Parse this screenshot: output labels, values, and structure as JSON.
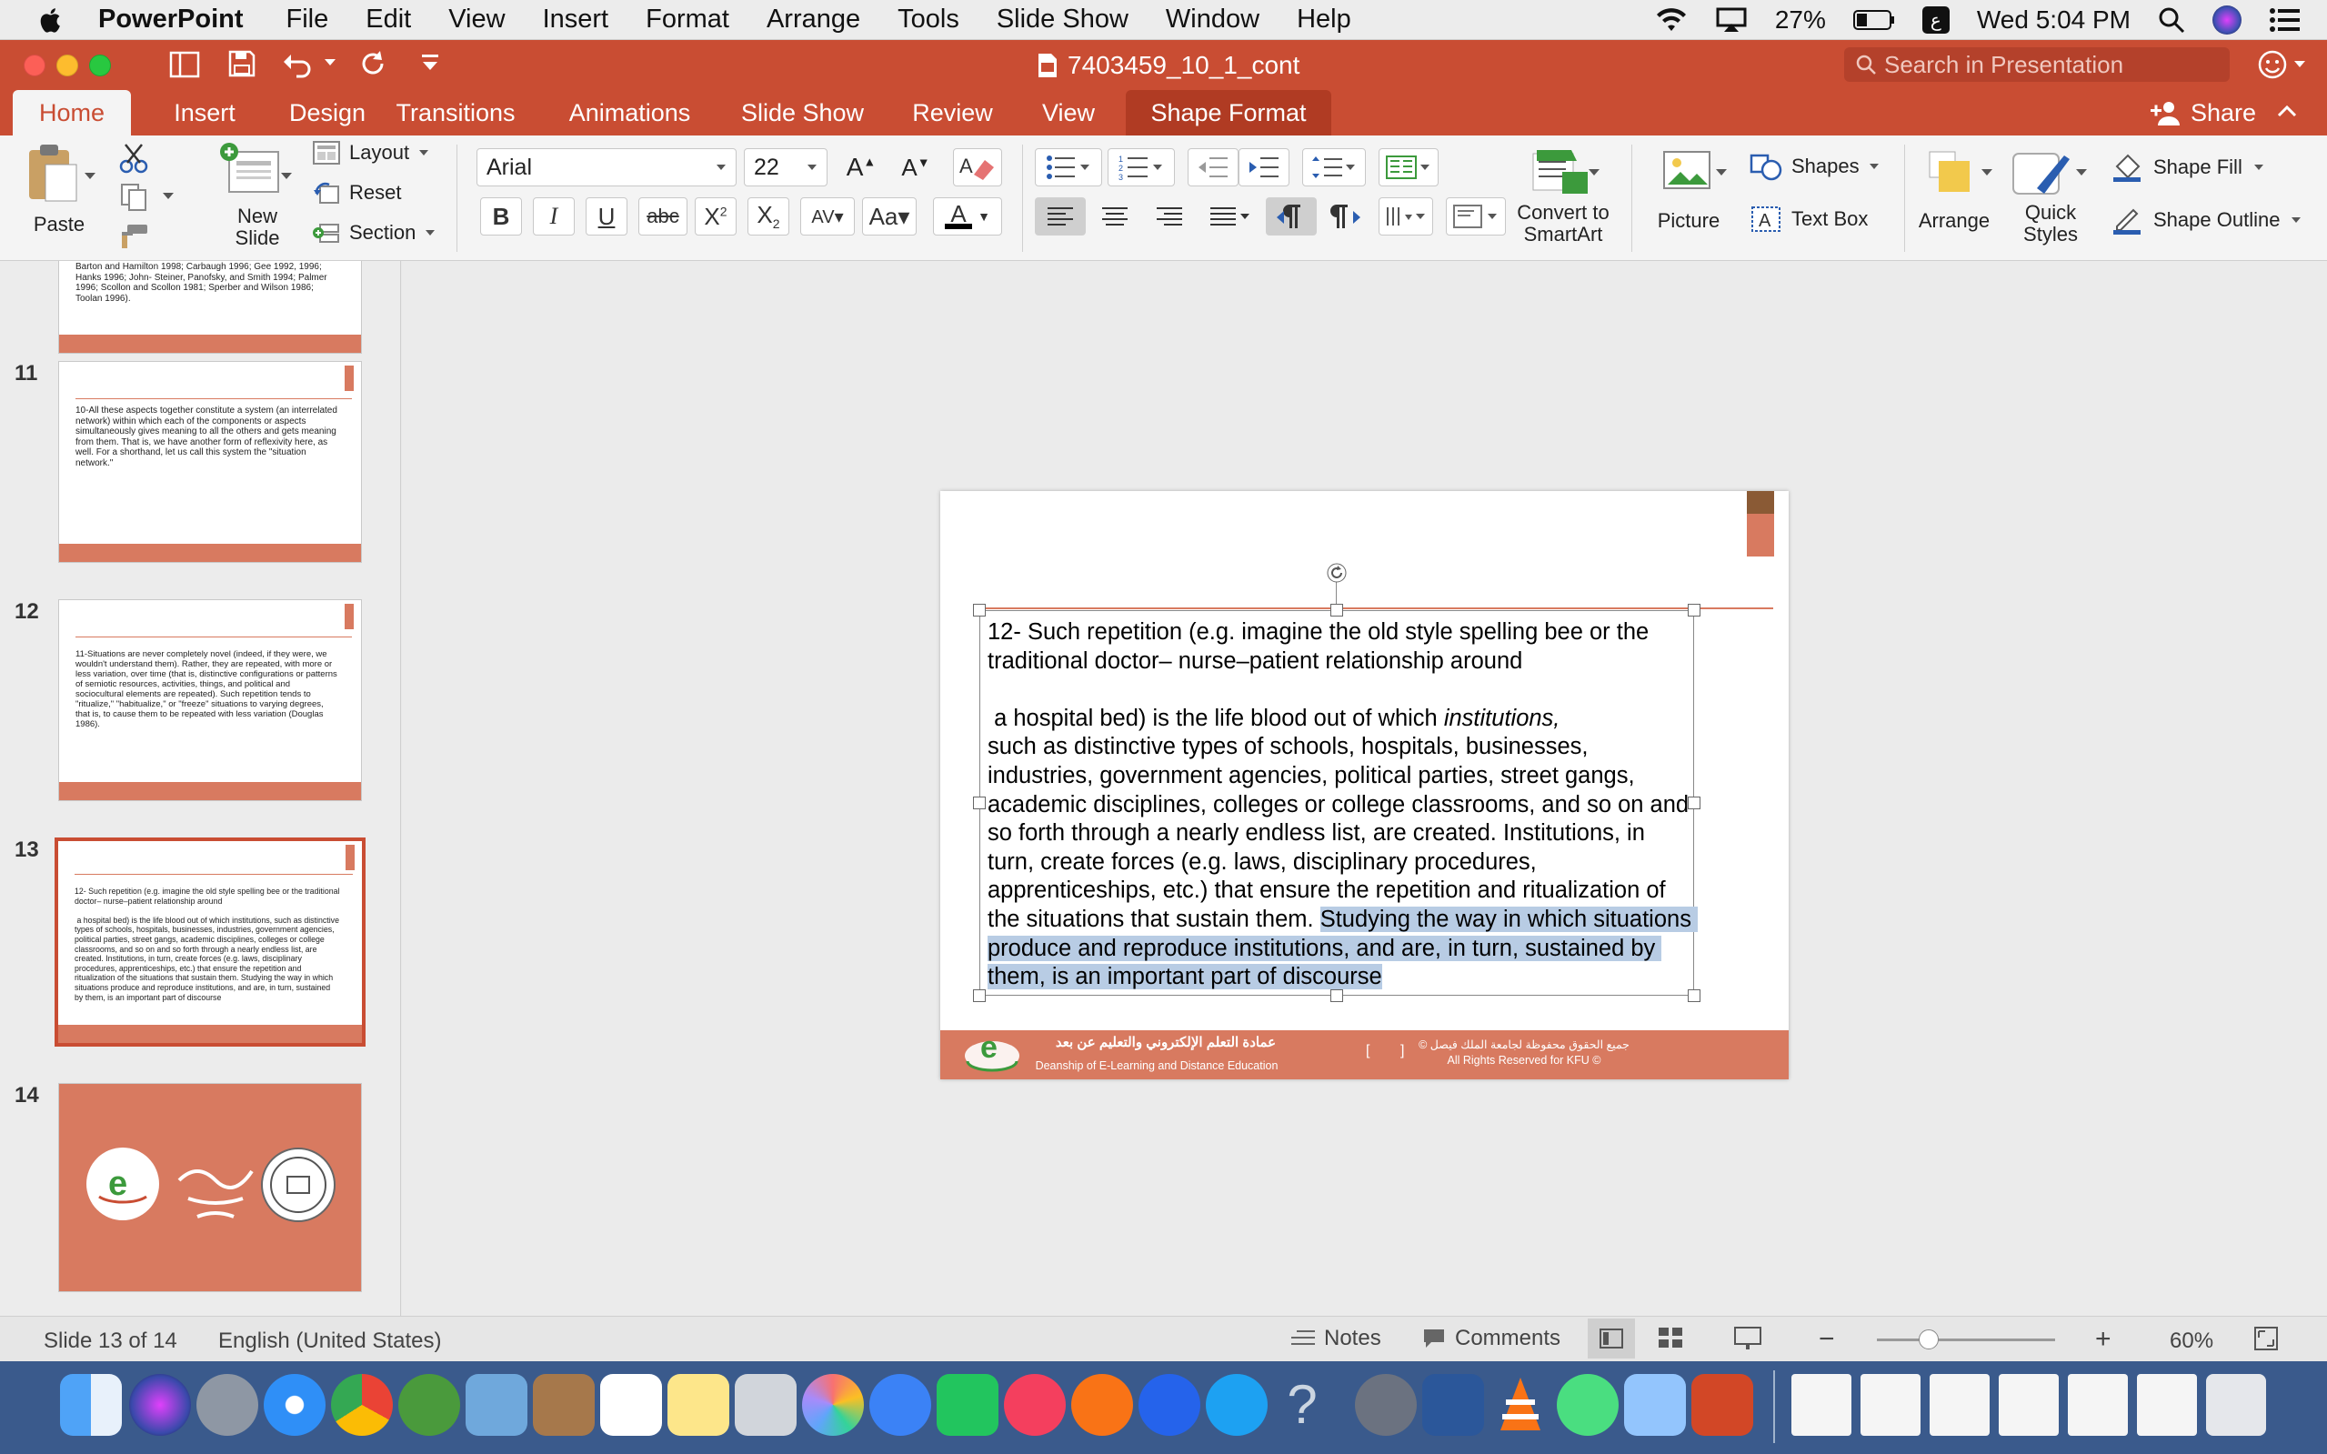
{
  "menubar": {
    "app": "PowerPoint",
    "items": [
      "File",
      "Edit",
      "View",
      "Insert",
      "Format",
      "Arrange",
      "Tools",
      "Slide Show",
      "Window",
      "Help"
    ],
    "battery": "27%",
    "clock": "Wed 5:04 PM"
  },
  "window": {
    "title": "7403459_10_1_cont",
    "search_placeholder": "Search in Presentation",
    "share": "Share"
  },
  "tabs": [
    "Home",
    "Insert",
    "Design",
    "Transitions",
    "Animations",
    "Slide Show",
    "Review",
    "View",
    "Shape Format"
  ],
  "ribbon": {
    "paste": "Paste",
    "new_slide": "New\nSlide",
    "layout": "Layout",
    "reset": "Reset",
    "section": "Section",
    "font_name": "Arial",
    "font_size": "22",
    "convert_smartart": "Convert to\nSmartArt",
    "picture": "Picture",
    "shapes": "Shapes",
    "text_box": "Text Box",
    "arrange": "Arrange",
    "quick_styles": "Quick\nStyles",
    "shape_fill": "Shape Fill",
    "shape_outline": "Shape Outline"
  },
  "thumbnails": [
    {
      "num": "",
      "text": "Barton and Hamilton 1998; Carbaugh 1996; Gee 1992, 1996; Hanks 1996; John- Steiner, Panofsky, and Smith 1994; Palmer 1996; Scollon and Scollon 1981; Sperber and Wilson 1986; Toolan 1996)."
    },
    {
      "num": "11",
      "text": "10-All these aspects together constitute a system (an interrelated network) within which each of the components or aspects simultaneously gives meaning to all the others and gets meaning from them. That is, we have another form of reflexivity here, as well. For a shorthand, let us call this system the \"situation network.\""
    },
    {
      "num": "12",
      "text": "11-Situations are never completely novel (indeed, if they were, we wouldn't understand them). Rather, they are repeated, with more or less variation, over time (that is, distinctive configurations or patterns of semiotic resources, activities, things, and political and sociocultural elements are repeated). Such repetition tends to \"ritualize,\" \"habitualize,\" or \"freeze\" situations to varying degrees, that is, to cause them to be repeated with less variation (Douglas 1986)."
    },
    {
      "num": "13",
      "text": "12- Such repetition (e.g. imagine the old style spelling bee or the traditional doctor– nurse–patient relationship around\n\n a hospital bed) is the life blood out of which institutions, such as distinctive types of schools, hospitals, businesses, industries, government agencies, political parties, street gangs, academic disciplines, colleges or college classrooms, and so on and so forth through a nearly endless list, are created. Institutions, in turn, create forces (e.g. laws, disciplinary procedures, apprenticeships, etc.) that ensure the repetition and ritualization of the situations that sustain them. Studying the way in which situations produce and reproduce institutions, and are, in turn, sustained by them, is an important part of discourse"
    },
    {
      "num": "14",
      "text": ""
    }
  ],
  "slide": {
    "para1": "12- Such repetition (e.g. imagine the old style spelling bee or the traditional doctor– nurse–patient relationship around",
    "para2a": " a hospital bed) is the life blood out of which ",
    "para2_italic": "institutions,",
    "para2b": "such as distinctive types of schools, hospitals, businesses, industries, government agencies, political parties, street gangs, academic disciplines, colleges or college classrooms, and so on and so forth through a nearly endless list, are created. Institutions, in turn, create forces (e.g. laws, disciplinary procedures, apprenticeships, etc.) that ensure the repetition and ritualization of the situations that sustain them. ",
    "para2_selected": "Studying the way in which situations produce and reproduce institutions, and are, in turn, sustained by them, is an important part of discourse",
    "footer_arabic": "عمادة التعلم الإلكتروني والتعليم عن بعد",
    "footer_english": "Deanship of E-Learning and Distance Education",
    "footer_rights_ar": "جميع الحقوق محفوظة لجامعة الملك فيصل ©",
    "footer_rights_en": "All Rights Reserved for KFU ©"
  },
  "status": {
    "slide_info": "Slide 13 of 14",
    "language": "English (United States)",
    "notes": "Notes",
    "comments": "Comments",
    "zoom": "60%"
  },
  "colors": {
    "accent": "#c94d33",
    "slide_footer": "#d87a60",
    "selection": "#b8cce4"
  }
}
